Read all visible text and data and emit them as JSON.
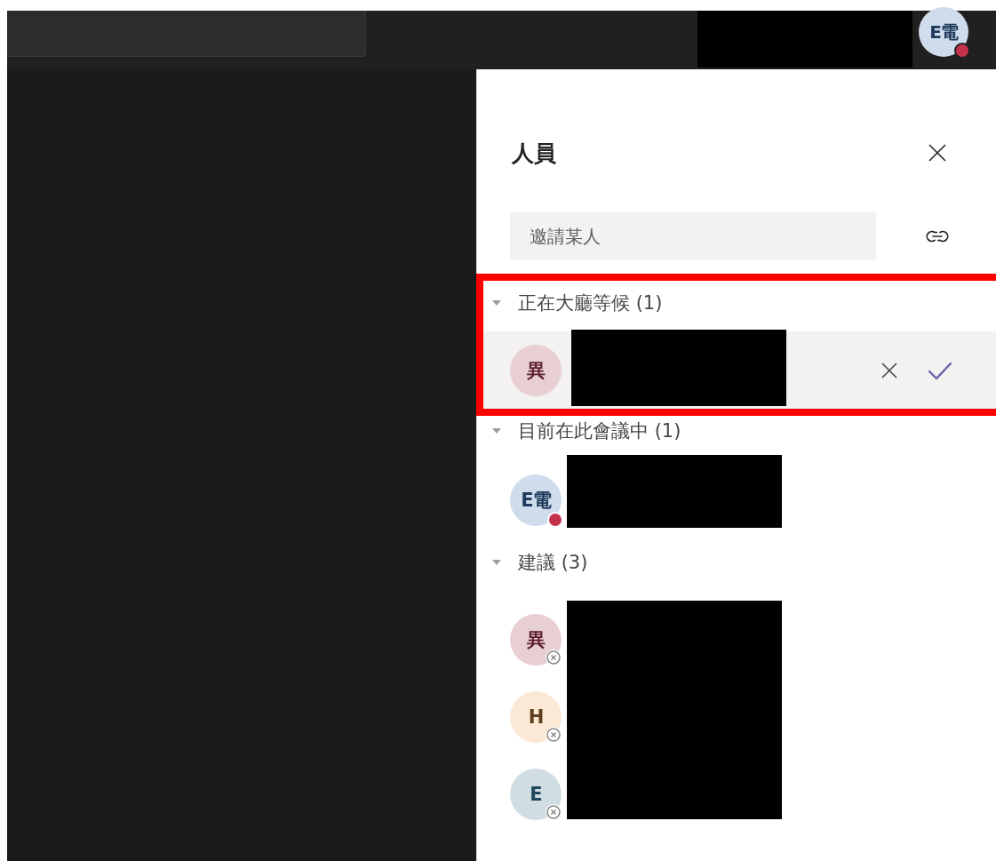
{
  "top_bar": {
    "avatar": {
      "initials": "E電",
      "color": "#cfdcec",
      "busy": true,
      "offline": false
    }
  },
  "panel": {
    "title": "人員",
    "invite": {
      "placeholder": "邀請某人"
    },
    "sections": [
      {
        "title": "正在大廳等候 (1)",
        "kind": "lobby",
        "expanded": true,
        "highlighted": true,
        "people": [
          {
            "initials": "異",
            "color": "#e8cfd4",
            "busy": false,
            "offline": false
          }
        ]
      },
      {
        "title": "目前在此會議中 (1)",
        "kind": "attendees",
        "expanded": true,
        "highlighted": false,
        "people": [
          {
            "initials": "E電",
            "color": "#cfdcec",
            "busy": true,
            "offline": false
          }
        ]
      },
      {
        "title": "建議 (3)",
        "kind": "suggestions",
        "expanded": true,
        "highlighted": false,
        "people": [
          {
            "initials": "異",
            "color": "#e8cfd4",
            "busy": false,
            "offline": true
          },
          {
            "initials": "H",
            "color": "#fbe9d5",
            "busy": false,
            "offline": true
          },
          {
            "initials": "E",
            "color": "#d0dde3",
            "busy": false,
            "offline": true
          }
        ]
      }
    ]
  }
}
